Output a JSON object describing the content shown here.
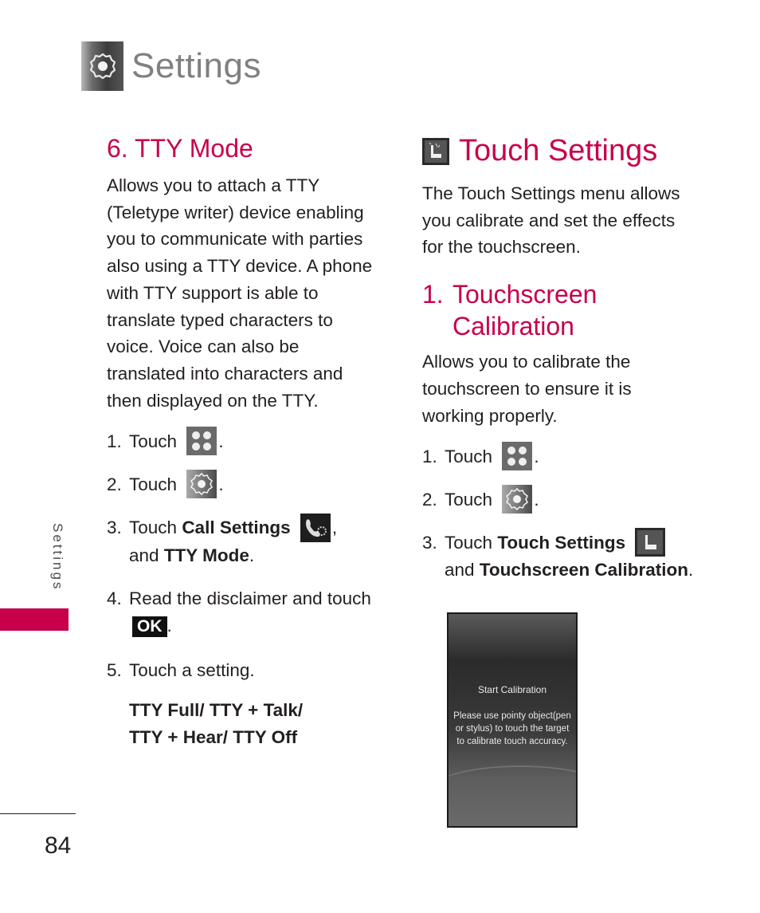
{
  "header": {
    "title": "Settings",
    "icon": "settings-gear-icon"
  },
  "left": {
    "heading": "6. TTY Mode",
    "intro": [
      "Allows you to attach a TTY",
      "(Teletype writer) device enabling",
      "you to communicate with parties",
      "also using a TTY device. A phone",
      "with TTY support is able to",
      "translate typed characters to",
      "voice. Voice can also be",
      "translated into characters and",
      "then displayed on the TTY."
    ],
    "steps": [
      {
        "num": "1.",
        "text": "Touch",
        "icon": "menu-grid-icon",
        "after": "."
      },
      {
        "num": "2.",
        "text": "Touch",
        "icon": "settings-gear-icon",
        "after": "."
      },
      {
        "num": "3.",
        "text": "Touch",
        "bold1": "Call Settings",
        "icon": "call-settings-icon",
        "after": ",",
        "line2_pre": "and",
        "bold2": "TTY Mode",
        "line2_after": "."
      },
      {
        "num": "4.",
        "text": "Read the disclaimer and touch",
        "button": "OK",
        "after": "."
      },
      {
        "num": "5.",
        "text": "Touch a setting."
      }
    ],
    "options_line1": "TTY Full/ TTY + Talk/",
    "options_line2": "TTY + Hear/ TTY Off"
  },
  "right": {
    "heading": "Touch Settings",
    "heading_icon": "touch-settings-icon",
    "intro": [
      "The Touch Settings menu allows",
      "you calibrate and set the effects",
      "for the touchscreen."
    ],
    "subheading_num": "1.",
    "subheading_line1": "Touchscreen",
    "subheading_line2": "Calibration",
    "sub_intro": [
      "Allows you to calibrate the",
      "touchscreen to ensure it is",
      "working properly."
    ],
    "steps": [
      {
        "num": "1.",
        "text": "Touch",
        "icon": "menu-grid-icon",
        "after": "."
      },
      {
        "num": "2.",
        "text": "Touch",
        "icon": "settings-gear-icon",
        "after": "."
      },
      {
        "num": "3.",
        "text": "Touch",
        "bold1": "Touch Settings",
        "icon": "touch-settings-icon",
        "line2_pre": "and",
        "bold2": "Touchscreen Calibration",
        "line2_after": "."
      }
    ],
    "screen": {
      "title": "Start Calibration",
      "message": "Please use pointy object(pen or stylus) to touch the target to calibrate touch accuracy."
    }
  },
  "side_tab": {
    "label": "Settings",
    "color": "#c8004b"
  },
  "footer": {
    "page_number": "84"
  },
  "colors": {
    "accent": "#c8004b",
    "text": "#231f20",
    "title_gray": "#808080"
  }
}
